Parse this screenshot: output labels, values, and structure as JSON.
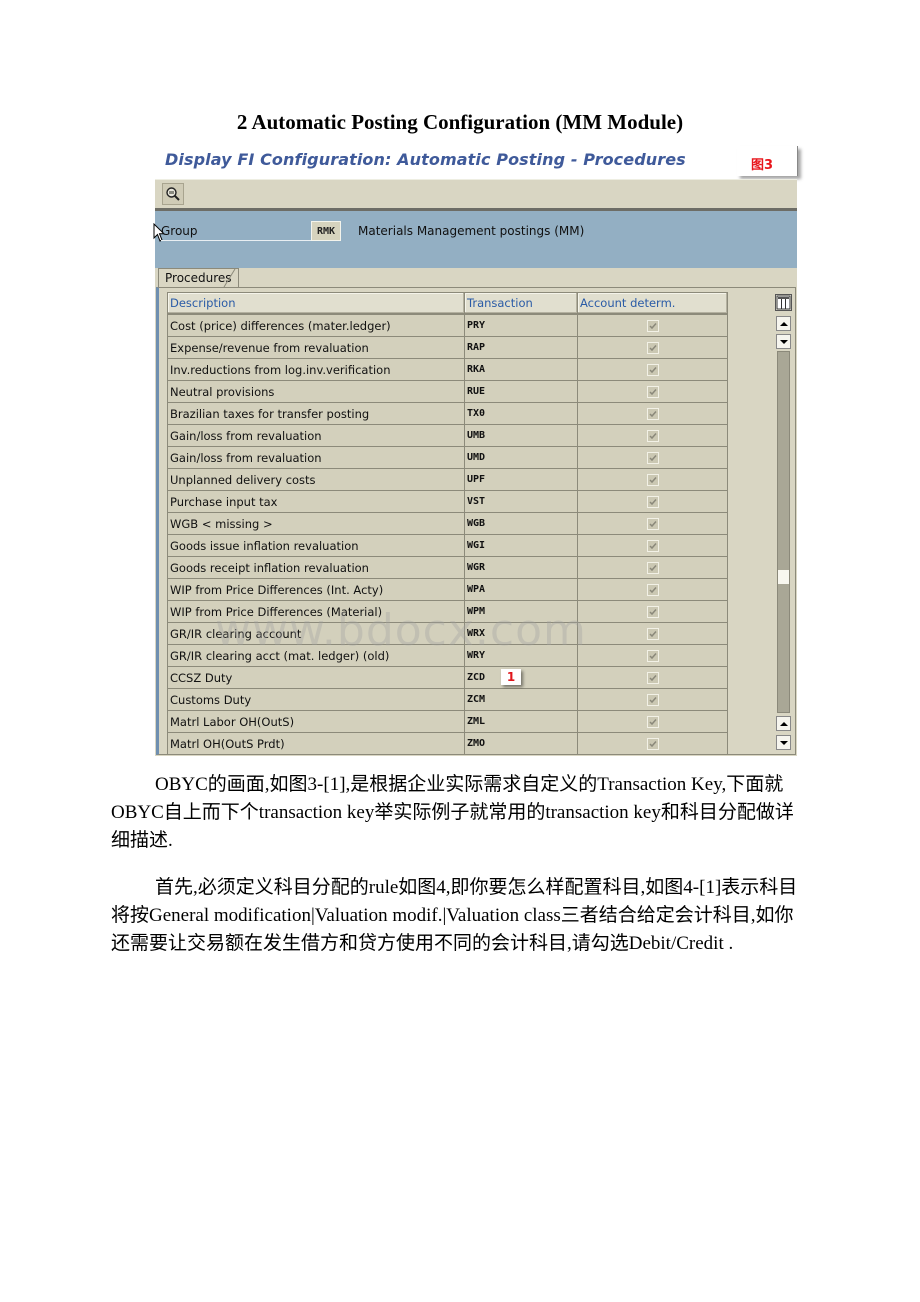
{
  "document": {
    "heading": "2 Automatic Posting Configuration (MM Module)",
    "paragraphs": [
      "OBYC的画面,如图3-[1],是根据企业实际需求自定义的Transaction Key,下面就OBYC自上而下个transaction key举实际例子就常用的transaction key和科目分配做详细描述.",
      "首先,必须定义科目分配的rule如图4,即你要怎么样配置科目,如图4-[1]表示科目将按General modification|Valuation modif.|Valuation class三者结合给定会计科目,如你还需要让交易额在发生借方和贷方使用不同的会计科目,请勾选Debit/Credit ."
    ],
    "watermark": "www.bdocx.com"
  },
  "sap": {
    "title": "Display FI Configuration: Automatic Posting - Procedures",
    "figure_label": "图3",
    "toolbar": {
      "icons": [
        "find-icon"
      ]
    },
    "group": {
      "label": "Group",
      "value": "RMK",
      "description": "Materials Management postings (MM)"
    },
    "tab_label": "Procedures",
    "columns": [
      "Description",
      "Transaction",
      "Account determ."
    ],
    "rows": [
      {
        "description": "Cost (price) differences (mater.ledger)",
        "transaction": "PRY",
        "account_determ": true
      },
      {
        "description": "Expense/revenue from revaluation",
        "transaction": "RAP",
        "account_determ": true
      },
      {
        "description": "Inv.reductions from log.inv.verification",
        "transaction": "RKA",
        "account_determ": true
      },
      {
        "description": "Neutral provisions",
        "transaction": "RUE",
        "account_determ": true
      },
      {
        "description": "Brazilian taxes for transfer posting",
        "transaction": "TX0",
        "account_determ": true
      },
      {
        "description": "Gain/loss from revaluation",
        "transaction": "UMB",
        "account_determ": true
      },
      {
        "description": "Gain/loss from revaluation",
        "transaction": "UMD",
        "account_determ": true
      },
      {
        "description": "Unplanned delivery costs",
        "transaction": "UPF",
        "account_determ": true
      },
      {
        "description": "Purchase input tax",
        "transaction": "VST",
        "account_determ": true
      },
      {
        "description": "WGB < missing >",
        "transaction": "WGB",
        "account_determ": true
      },
      {
        "description": "Goods issue inflation revaluation",
        "transaction": "WGI",
        "account_determ": true
      },
      {
        "description": "Goods receipt inflation revaluation",
        "transaction": "WGR",
        "account_determ": true
      },
      {
        "description": "WIP from Price Differences (Int. Acty)",
        "transaction": "WPA",
        "account_determ": true
      },
      {
        "description": "WIP from Price Differences (Material)",
        "transaction": "WPM",
        "account_determ": true
      },
      {
        "description": "GR/IR clearing account",
        "transaction": "WRX",
        "account_determ": true
      },
      {
        "description": "GR/IR clearing acct (mat. ledger) (old)",
        "transaction": "WRY",
        "account_determ": true
      },
      {
        "description": "CCSZ Duty",
        "transaction": "ZCD",
        "account_determ": true,
        "annotation": "1"
      },
      {
        "description": "Customs Duty",
        "transaction": "ZCM",
        "account_determ": true
      },
      {
        "description": "Matrl Labor OH(OutS)",
        "transaction": "ZML",
        "account_determ": true
      },
      {
        "description": "Matrl  OH(OutS Prdt)",
        "transaction": "ZMO",
        "account_determ": true
      }
    ],
    "scroll_position": 0.63
  }
}
